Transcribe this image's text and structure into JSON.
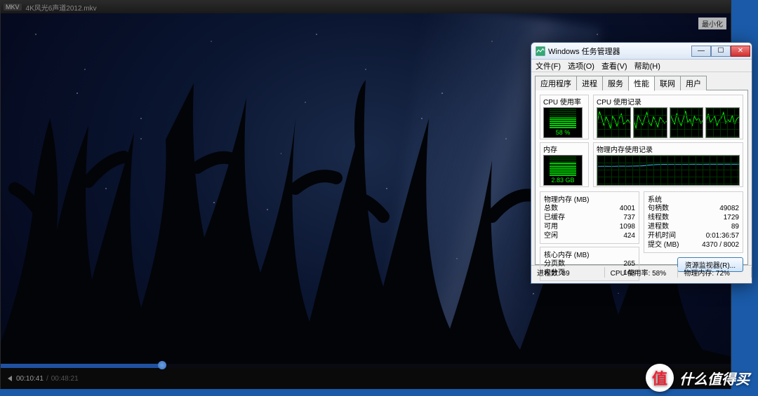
{
  "player": {
    "badge": "MKV",
    "title": "4K风光6声道2012.mkv",
    "minimize_label": "最小化",
    "time_current": "00:10:41",
    "time_total": "00:48:21",
    "progress_percent": 22.1
  },
  "taskmgr": {
    "title": "Windows 任务管理器",
    "menu": {
      "file": "文件(F)",
      "options": "选项(O)",
      "view": "查看(V)",
      "help": "帮助(H)"
    },
    "tabs": {
      "applications": "应用程序",
      "processes": "进程",
      "services": "服务",
      "performance": "性能",
      "networking": "联网",
      "users": "用户"
    },
    "active_tab": "performance",
    "cpu_usage_label": "CPU 使用率",
    "cpu_history_label": "CPU 使用记录",
    "memory_label": "内存",
    "memory_history_label": "物理内存使用记录",
    "cpu_percent_text": "58 %",
    "cpu_percent": 58,
    "memory_value_text": "2.83 GB",
    "phys_mem_title": "物理内存 (MB)",
    "phys_mem": {
      "total_label": "总数",
      "total": "4001",
      "cached_label": "已缓存",
      "cached": "737",
      "available_label": "可用",
      "available": "1098",
      "free_label": "空闲",
      "free": "424"
    },
    "kernel_mem_title": "核心内存 (MB)",
    "kernel_mem": {
      "paged_label": "分页数",
      "paged": "265",
      "nonpaged_label": "未分页",
      "nonpaged": "143"
    },
    "system_title": "系统",
    "system": {
      "handles_label": "句柄数",
      "handles": "49082",
      "threads_label": "线程数",
      "threads": "1729",
      "processes_label": "进程数",
      "processes": "89",
      "uptime_label": "开机时间",
      "uptime": "0:01:36:57",
      "commit_label": "提交 (MB)",
      "commit": "4370 / 8002"
    },
    "resmon_button": "资源监视器(R)...",
    "status": {
      "processes": "进程数: 89",
      "cpu": "CPU 使用率: 58%",
      "mem": "物理内存: 72%"
    }
  },
  "watermark": {
    "badge": "值",
    "text": "什么值得买"
  },
  "chart_data": [
    {
      "type": "line",
      "title": "CPU 使用记录 core 1",
      "ylim": [
        0,
        100
      ],
      "x": [
        0,
        1,
        2,
        3,
        4,
        5,
        6,
        7,
        8,
        9,
        10,
        11,
        12,
        13,
        14,
        15
      ],
      "values": [
        50,
        88,
        66,
        40,
        70,
        55,
        30,
        72,
        60,
        38,
        65,
        80,
        45,
        52,
        60,
        48
      ]
    },
    {
      "type": "line",
      "title": "CPU 使用记录 core 2",
      "ylim": [
        0,
        100
      ],
      "x": [
        0,
        1,
        2,
        3,
        4,
        5,
        6,
        7,
        8,
        9,
        10,
        11,
        12,
        13,
        14,
        15
      ],
      "values": [
        62,
        30,
        75,
        58,
        42,
        66,
        85,
        50,
        40,
        70,
        55,
        35,
        68,
        60,
        48,
        55
      ]
    },
    {
      "type": "line",
      "title": "CPU 使用记录 core 3",
      "ylim": [
        0,
        100
      ],
      "x": [
        0,
        1,
        2,
        3,
        4,
        5,
        6,
        7,
        8,
        9,
        10,
        11,
        12,
        13,
        14,
        15
      ],
      "values": [
        78,
        60,
        45,
        82,
        55,
        40,
        65,
        90,
        50,
        62,
        38,
        72,
        58,
        66,
        48,
        60
      ]
    },
    {
      "type": "line",
      "title": "CPU 使用记录 core 4",
      "ylim": [
        0,
        100
      ],
      "x": [
        0,
        1,
        2,
        3,
        4,
        5,
        6,
        7,
        8,
        9,
        10,
        11,
        12,
        13,
        14,
        15
      ],
      "values": [
        55,
        80,
        50,
        62,
        72,
        40,
        58,
        66,
        85,
        48,
        60,
        52,
        75,
        44,
        62,
        70
      ]
    },
    {
      "type": "area",
      "title": "物理内存使用记录",
      "ylabel": "GB",
      "ylim": [
        0,
        4
      ],
      "x": [
        0,
        1,
        2,
        3,
        4,
        5,
        6,
        7,
        8,
        9,
        10,
        11,
        12,
        13,
        14,
        15,
        16,
        17,
        18,
        19
      ],
      "values": [
        2.55,
        2.56,
        2.55,
        2.57,
        2.56,
        2.58,
        2.6,
        2.72,
        2.78,
        2.8,
        2.81,
        2.82,
        2.82,
        2.83,
        2.82,
        2.83,
        2.83,
        2.83,
        2.83,
        2.83
      ]
    }
  ]
}
